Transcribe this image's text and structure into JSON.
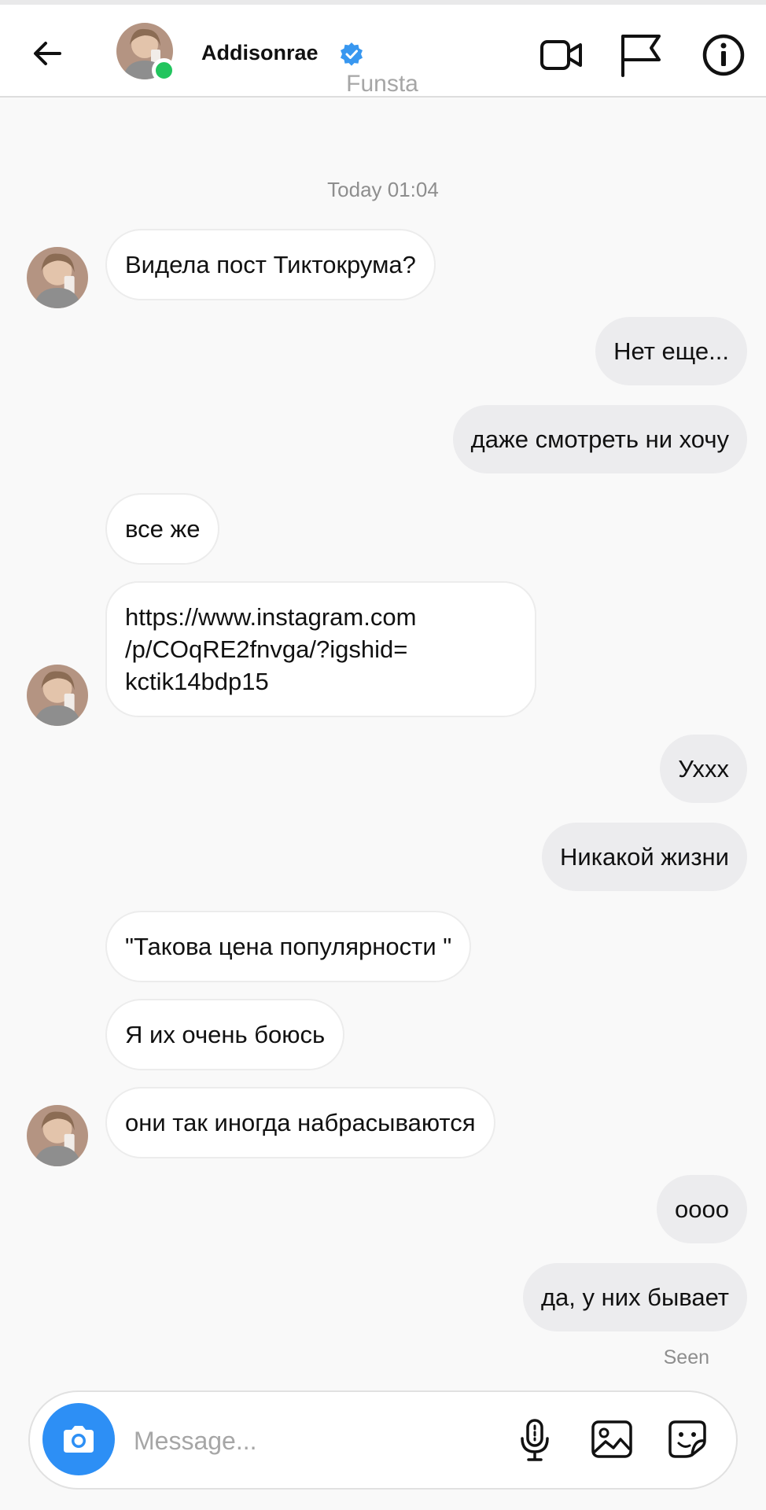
{
  "header": {
    "username": "Addisonrae",
    "subtitle": "Funsta",
    "icons": [
      "back-arrow-icon",
      "video-call-icon",
      "report-flag-icon",
      "info-icon"
    ],
    "verified_color": "#3897f0",
    "online_color": "#22c55e"
  },
  "chat": {
    "timestamp": "Today 01:04",
    "messages": [
      {
        "from": "them",
        "text": "Видела пост Тиктокрума?"
      },
      {
        "from": "me",
        "text": "Нет еще..."
      },
      {
        "from": "me",
        "text": "даже смотреть ни хочу"
      },
      {
        "from": "them",
        "text": "все же"
      },
      {
        "from": "them",
        "text": "https://www.instagram.com\n/p/COqRE2fnvga/?igshid=\nkctik14bdp15"
      },
      {
        "from": "me",
        "text": "Ухxx"
      },
      {
        "from": "me",
        "text": "Никакой жизни"
      },
      {
        "from": "them",
        "text": "\"Такова цена популярности \""
      },
      {
        "from": "them",
        "text": "Я их очень боюсь"
      },
      {
        "from": "them",
        "text": "они так иногда набрасываются"
      },
      {
        "from": "me",
        "text": "оооо"
      },
      {
        "from": "me",
        "text": "да, у них бывает"
      }
    ],
    "seen_label": "Seen"
  },
  "composer": {
    "placeholder": "Message...",
    "icons": [
      "camera-icon",
      "microphone-icon",
      "gallery-icon",
      "sticker-icon"
    ],
    "camera_color": "#2d8ff5"
  }
}
